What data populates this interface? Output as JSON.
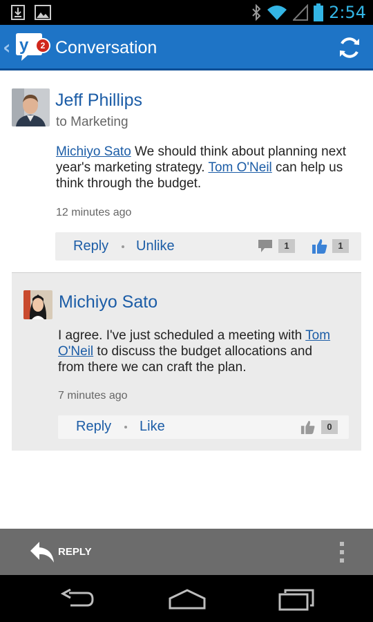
{
  "status_bar": {
    "time": "2:54",
    "left_icons": [
      "download-icon",
      "image-icon"
    ],
    "right_icons": [
      "bluetooth-icon",
      "wifi-icon",
      "signal-icon",
      "battery-icon"
    ]
  },
  "action_bar": {
    "title": "Conversation",
    "logo_letters": "y",
    "badge_count": "2",
    "refresh_icon": "refresh-icon"
  },
  "post": {
    "author": "Jeff Phillips",
    "audience": "to Marketing",
    "mention_1": "Michiyo Sato",
    "text_1": " We should think about planning next year's marketing strategy. ",
    "mention_2": "Tom O'Neil",
    "text_2": " can help us think through the budget.",
    "time": "12 minutes ago",
    "reply_label": "Reply",
    "like_label": "Unlike",
    "comment_count": "1",
    "like_count": "1"
  },
  "reply": {
    "author": "Michiyo Sato",
    "text_1": "I agree. I've just scheduled a meeting with ",
    "mention": "Tom O'Neil",
    "text_2": " to discuss the budget allocations and from there we can craft the plan.",
    "time": "7 minutes ago",
    "reply_label": "Reply",
    "like_label": "Like",
    "like_count": "0"
  },
  "bottom_bar": {
    "reply_label": "REPLY"
  },
  "colors": {
    "action_bar": "#1e74c6",
    "link": "#1b5ca6",
    "status_time": "#33b5e5"
  }
}
